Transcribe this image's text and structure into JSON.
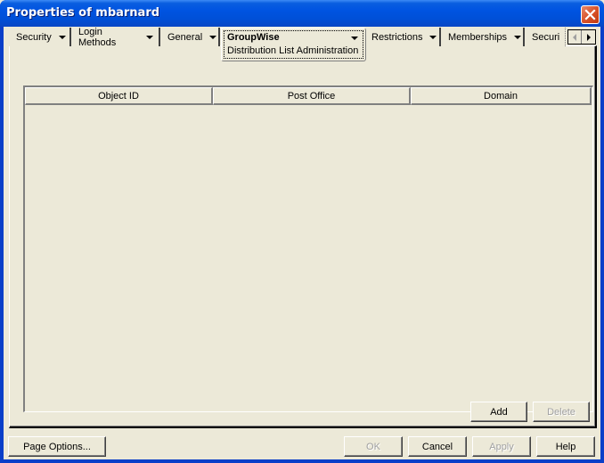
{
  "window": {
    "title": "Properties of mbarnard",
    "close_icon": "close-icon"
  },
  "tabs": [
    {
      "label": "Security",
      "has_dropdown": true
    },
    {
      "label": "Login Methods",
      "has_dropdown": true
    },
    {
      "label": "General",
      "has_dropdown": true
    },
    {
      "label": "GroupWise",
      "subtitle": "Distribution List Administration",
      "has_dropdown": true,
      "active": true
    },
    {
      "label": "Restrictions",
      "has_dropdown": true
    },
    {
      "label": "Memberships",
      "has_dropdown": true
    },
    {
      "label": "Securi",
      "has_dropdown": false,
      "truncated": true
    }
  ],
  "tab_scroll": {
    "left_icon": "scroll-left-icon",
    "right_icon": "scroll-right-icon"
  },
  "table": {
    "columns": [
      "Object ID",
      "Post Office",
      "Domain"
    ],
    "rows": []
  },
  "panel_buttons": {
    "add": {
      "label": "Add",
      "enabled": true
    },
    "delete": {
      "label": "Delete",
      "enabled": false
    }
  },
  "footer": {
    "page_options": {
      "label": "Page Options...",
      "enabled": true
    },
    "ok": {
      "label": "OK",
      "enabled": false
    },
    "cancel": {
      "label": "Cancel",
      "enabled": true
    },
    "apply": {
      "label": "Apply",
      "enabled": false
    },
    "help": {
      "label": "Help",
      "enabled": true
    }
  }
}
